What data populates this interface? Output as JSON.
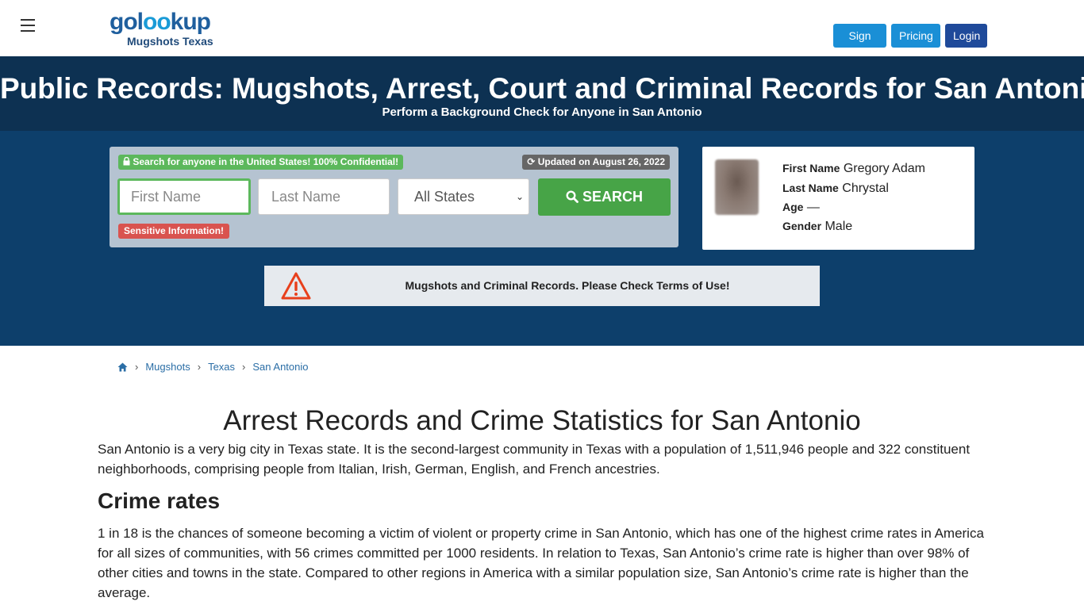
{
  "header": {
    "logo_main": "golookup",
    "logo_sub": "Mugshots Texas",
    "signup_label": "Sign Up",
    "pricing_label": "Pricing",
    "login_label": "Login"
  },
  "hero": {
    "title": "Public Records: Mugshots, Arrest, Court and Criminal Records for San Antonio!",
    "subtitle": "Perform a Background Check for Anyone in San Antonio"
  },
  "search": {
    "confidential_badge": "Search for anyone in the United States! 100% Confidential!",
    "updated_badge": "Updated on August 26, 2022",
    "first_name_placeholder": "First Name",
    "last_name_placeholder": "Last Name",
    "state_selected": "All States",
    "search_label": "SEARCH",
    "sensitive_badge": "Sensitive Information!"
  },
  "profile": {
    "first_name_label": "First Name",
    "first_name_value": "Gregory Adam",
    "last_name_label": "Last Name",
    "last_name_value": "Chrystal",
    "age_label": "Age",
    "age_value": "—",
    "gender_label": "Gender",
    "gender_value": "Male"
  },
  "notice": {
    "text": "Mugshots and Criminal Records. Please Check Terms of Use!"
  },
  "breadcrumb": {
    "items": [
      "Mugshots",
      "Texas",
      "San Antonio"
    ]
  },
  "content": {
    "heading": "Arrest Records and Crime Statistics for San Antonio",
    "intro": "San Antonio is a very big city in Texas state. It is the second-largest community in Texas with a population of 1,511,946 people and 322 constituent neighborhoods, comprising people from Italian, Irish, German, English, and French ancestries.",
    "crime_heading": "Crime rates",
    "crime_text": "1 in 18 is the chances of someone becoming a victim of violent or property crime in San Antonio, which has one of the highest crime rates in America for all sizes of communities, with 56 crimes committed per 1000 residents. In relation to Texas, San Antonio’s crime rate is higher than over 98% of other cities and towns in the state. Compared to other regions in America with a similar population size, San Antonio’s crime rate is higher than the average."
  },
  "icons": {
    "menu": "hamburger-icon",
    "lock": "lock-icon",
    "refresh": "refresh-icon",
    "search": "search-icon",
    "warning": "warning-icon",
    "home": "home-icon"
  },
  "colors": {
    "hero_bg": "#0d3152",
    "band_bg": "#0d3f6b",
    "green": "#5cb85c",
    "red": "#d9534f",
    "blue": "#1a8fd6",
    "warning": "#e8401c"
  }
}
